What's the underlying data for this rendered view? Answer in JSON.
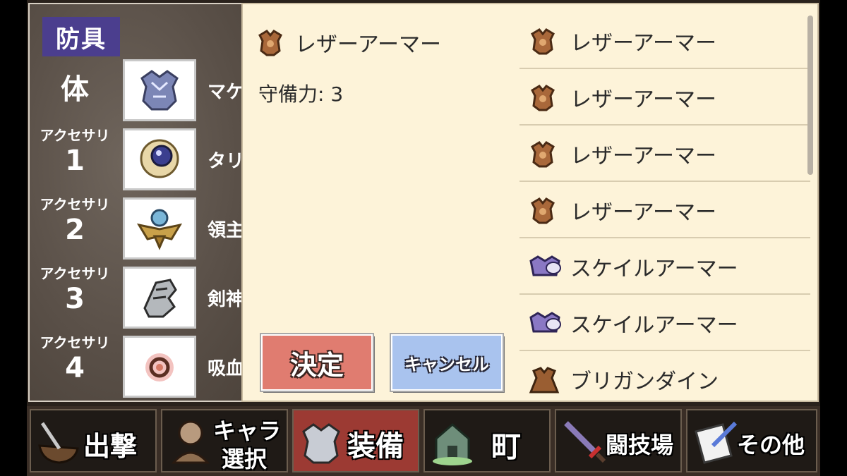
{
  "equipment_panel": {
    "category": "防具",
    "slots": [
      {
        "label_small": "",
        "label_large": "体",
        "item_name": "マケ"
      },
      {
        "label_small": "アクセサリ",
        "label_large": "1",
        "item_name": "タリ"
      },
      {
        "label_small": "アクセサリ",
        "label_large": "2",
        "item_name": "領主"
      },
      {
        "label_small": "アクセサリ",
        "label_large": "3",
        "item_name": "剣神"
      },
      {
        "label_small": "アクセサリ",
        "label_large": "4",
        "item_name": "吸血"
      }
    ]
  },
  "detail": {
    "item_name": "レザーアーマー",
    "stat": "守備力: 3",
    "confirm_label": "決定",
    "cancel_label": "キャンセル"
  },
  "item_list": [
    {
      "name": "レザーアーマー",
      "icon": "leather-armor-icon"
    },
    {
      "name": "レザーアーマー",
      "icon": "leather-armor-icon"
    },
    {
      "name": "レザーアーマー",
      "icon": "leather-armor-icon"
    },
    {
      "name": "レザーアーマー",
      "icon": "leather-armor-icon"
    },
    {
      "name": "スケイルアーマー",
      "icon": "scale-armor-icon"
    },
    {
      "name": "スケイルアーマー",
      "icon": "scale-armor-icon"
    },
    {
      "name": "ブリガンダイン",
      "icon": "brigandine-icon"
    }
  ],
  "nav": [
    {
      "label": "出撃",
      "icon": "sortie-icon"
    },
    {
      "label_top": "キャラ",
      "label_bottom": "選択",
      "icon": "character-select-icon"
    },
    {
      "label": "装備",
      "icon": "equipment-icon",
      "active": true
    },
    {
      "label": "町",
      "icon": "town-icon"
    },
    {
      "label": "闘技場",
      "icon": "arena-icon"
    },
    {
      "label": "その他",
      "icon": "other-icon"
    }
  ],
  "colors": {
    "popup_bg": "#fdf3d9",
    "confirm_button": "#e07c70",
    "cancel_button": "#a9c3ee",
    "category_badge": "#4b3e8e",
    "nav_active": "#9c3a33"
  }
}
